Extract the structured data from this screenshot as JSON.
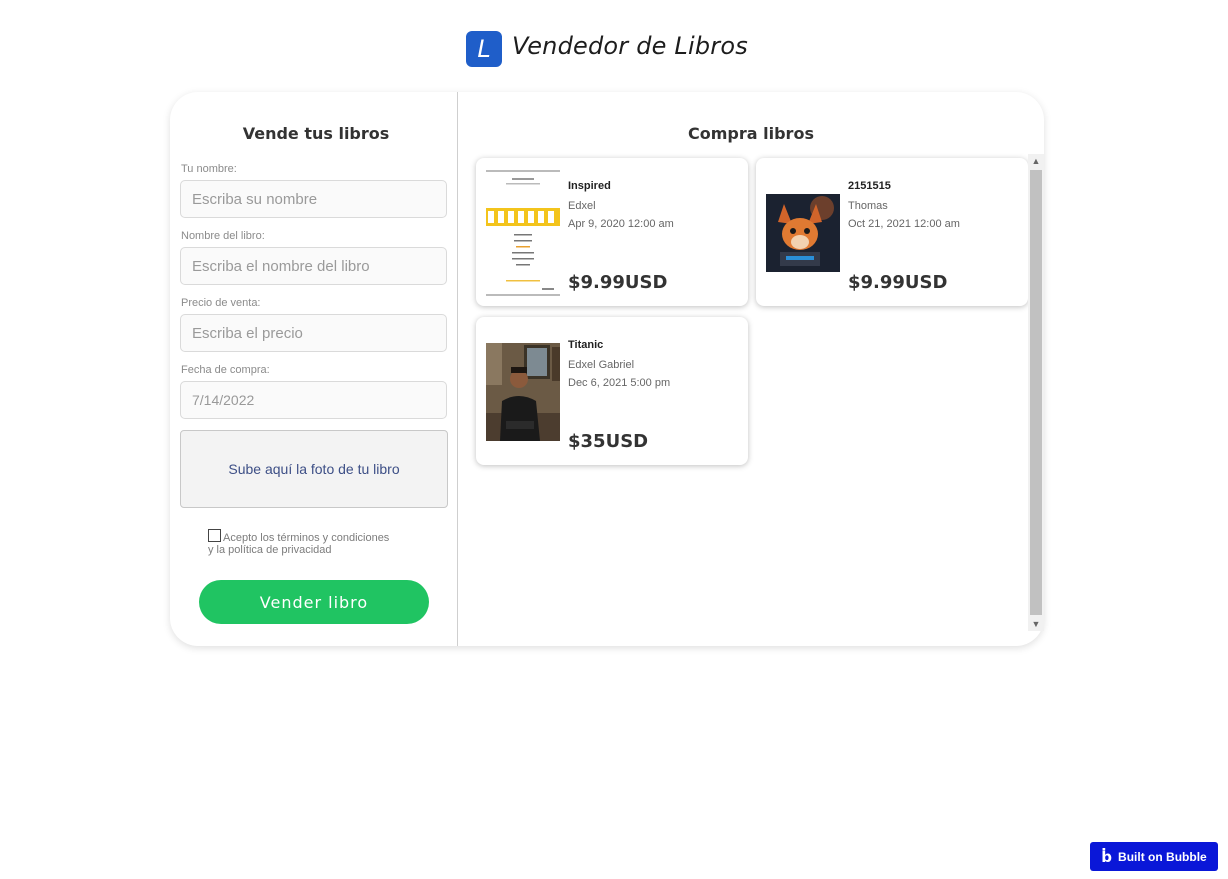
{
  "header": {
    "logo_letter": "L",
    "title": "Vendedor de Libros"
  },
  "sell": {
    "title": "Vende tus libros",
    "name_label": "Tu nombre:",
    "name_placeholder": "Escriba su nombre",
    "book_label": "Nombre del libro:",
    "book_placeholder": "Escriba el nombre del libro",
    "price_label": "Precio de venta:",
    "price_placeholder": "Escriba el precio",
    "date_label": "Fecha de compra:",
    "date_value": "7/14/2022",
    "upload_label": "Sube aquí la foto de tu libro",
    "terms_line1": "Acepto los términos y condiciones",
    "terms_line2": "y la política de privacidad",
    "terms_checked": false,
    "button_label": "Vender libro"
  },
  "buy": {
    "title": "Compra libros",
    "books": [
      {
        "name": "Inspired",
        "seller": "Edxel",
        "date": "Apr 9, 2020 12:00 am",
        "price": "$9.99USD",
        "image": "book-cover-inspired"
      },
      {
        "name": "2151515",
        "seller": "Thomas",
        "date": "Oct 21, 2021 12:00 am",
        "price": "$9.99USD",
        "image": "book-cover-fox"
      },
      {
        "name": "Titanic",
        "seller": "Edxel Gabriel",
        "date": "Dec 6, 2021 5:00 pm",
        "price": "$35USD",
        "image": "book-photo-person"
      }
    ]
  },
  "badge": {
    "label": "Built on Bubble",
    "icon": "bubble-logo-icon"
  },
  "colors": {
    "accent_blue": "#1f5ec9",
    "button_green": "#20c462",
    "badge_blue": "#0a17d8"
  }
}
